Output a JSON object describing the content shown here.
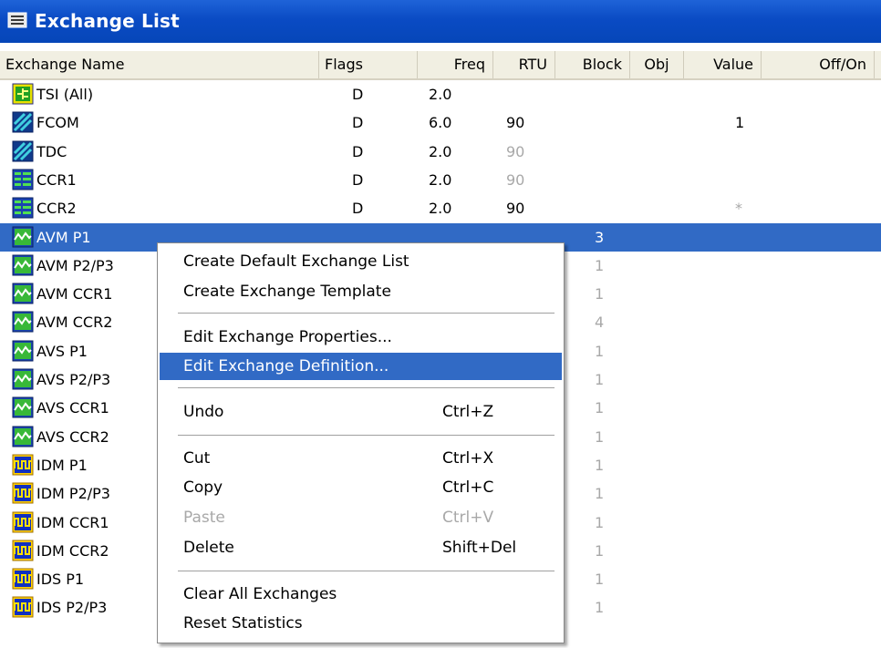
{
  "window": {
    "title": "Exchange List"
  },
  "columns": [
    "Exchange Name",
    "Flags",
    "Freq",
    "RTU",
    "Block",
    "Obj",
    "Value",
    "Off/On"
  ],
  "rows": [
    {
      "name": "TSI (All)",
      "icon": "tsi-icon",
      "flags": "D",
      "freq": "2.0",
      "rtu": "",
      "block": "",
      "value": ""
    },
    {
      "name": "FCOM",
      "icon": "fcom-icon",
      "flags": "D",
      "freq": "6.0",
      "rtu": "90",
      "block": "",
      "value": "1"
    },
    {
      "name": "TDC",
      "icon": "tdc-icon",
      "flags": "D",
      "freq": "2.0",
      "rtu": "90",
      "block": "",
      "value": ""
    },
    {
      "name": "CCR1",
      "icon": "ccr-icon",
      "flags": "D",
      "freq": "2.0",
      "rtu": "90",
      "block": "",
      "value": ""
    },
    {
      "name": "CCR2",
      "icon": "ccr-icon",
      "flags": "D",
      "freq": "2.0",
      "rtu": "90",
      "block": "",
      "value": "*"
    },
    {
      "name": "AVM P1",
      "icon": "waveform-icon",
      "flags": "",
      "freq": "",
      "rtu": "",
      "block": "3",
      "value": ""
    },
    {
      "name": "AVM P2/P3",
      "icon": "waveform-icon",
      "flags": "",
      "freq": "",
      "rtu": "",
      "block": "1",
      "value": ""
    },
    {
      "name": "AVM CCR1",
      "icon": "waveform-icon",
      "flags": "",
      "freq": "",
      "rtu": "",
      "block": "1",
      "value": ""
    },
    {
      "name": "AVM CCR2",
      "icon": "waveform-icon",
      "flags": "",
      "freq": "",
      "rtu": "",
      "block": "4",
      "value": ""
    },
    {
      "name": "AVS P1",
      "icon": "waveform-icon",
      "flags": "",
      "freq": "",
      "rtu": "",
      "block": "1",
      "value": ""
    },
    {
      "name": "AVS P2/P3",
      "icon": "waveform-icon",
      "flags": "",
      "freq": "",
      "rtu": "",
      "block": "1",
      "value": ""
    },
    {
      "name": "AVS CCR1",
      "icon": "waveform-icon",
      "flags": "",
      "freq": "",
      "rtu": "",
      "block": "1",
      "value": ""
    },
    {
      "name": "AVS CCR2",
      "icon": "waveform-icon",
      "flags": "",
      "freq": "",
      "rtu": "",
      "block": "1",
      "value": ""
    },
    {
      "name": "IDM P1",
      "icon": "pulse-icon",
      "flags": "",
      "freq": "",
      "rtu": "",
      "block": "1",
      "value": ""
    },
    {
      "name": "IDM P2/P3",
      "icon": "pulse-icon",
      "flags": "",
      "freq": "",
      "rtu": "",
      "block": "1",
      "value": ""
    },
    {
      "name": "IDM CCR1",
      "icon": "pulse-icon",
      "flags": "",
      "freq": "",
      "rtu": "",
      "block": "1",
      "value": ""
    },
    {
      "name": "IDM CCR2",
      "icon": "pulse-icon",
      "flags": "",
      "freq": "",
      "rtu": "",
      "block": "1",
      "value": ""
    },
    {
      "name": "IDS P1",
      "icon": "pulse-icon",
      "flags": "",
      "freq": "",
      "rtu": "",
      "block": "1",
      "value": ""
    },
    {
      "name": "IDS P2/P3",
      "icon": "pulse-icon",
      "flags": "",
      "freq": "",
      "rtu": "",
      "block": "1",
      "value": ""
    }
  ],
  "context_menu": {
    "items": [
      {
        "label": "Create Default Exchange List",
        "shortcut": ""
      },
      {
        "label": "Create Exchange Template",
        "shortcut": ""
      },
      {
        "label": "Edit Exchange Properties...",
        "shortcut": ""
      },
      {
        "label": "Edit Exchange Definition...",
        "shortcut": ""
      },
      {
        "label": "Undo",
        "shortcut": "Ctrl+Z"
      },
      {
        "label": "Cut",
        "shortcut": "Ctrl+X"
      },
      {
        "label": "Copy",
        "shortcut": "Ctrl+C"
      },
      {
        "label": "Paste",
        "shortcut": "Ctrl+V"
      },
      {
        "label": "Delete",
        "shortcut": "Shift+Del"
      },
      {
        "label": "Clear All Exchanges",
        "shortcut": ""
      },
      {
        "label": "Reset Statistics",
        "shortcut": ""
      }
    ]
  },
  "colors": {
    "titlebar": "#0a4bc4",
    "selection": "#316ac5",
    "header_bg": "#f1efe2",
    "dim_text": "#a8a8a8"
  }
}
